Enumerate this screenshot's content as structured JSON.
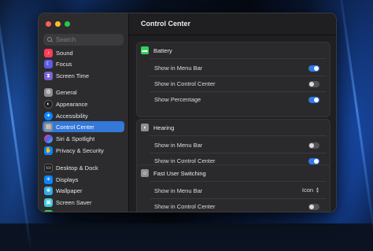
{
  "sidebar": {
    "search_placeholder": "Search",
    "items": [
      {
        "label": "Sound",
        "icon": "speaker-icon",
        "color": "#ff3b58"
      },
      {
        "label": "Focus",
        "icon": "moon-icon",
        "color": "#5e5ce6"
      },
      {
        "label": "Screen Time",
        "icon": "hourglass-icon",
        "color": "#7b61d9"
      },
      {
        "label": "General",
        "icon": "gear-icon",
        "color": "#8e8e93"
      },
      {
        "label": "Appearance",
        "icon": "appearance-icon",
        "color": "#1c1c1e"
      },
      {
        "label": "Accessibility",
        "icon": "accessibility-icon",
        "color": "#0a84ff"
      },
      {
        "label": "Control Center",
        "icon": "control-center-icon",
        "color": "#8e8e93"
      },
      {
        "label": "Siri & Spotlight",
        "icon": "siri-icon",
        "color": "#bf5af2"
      },
      {
        "label": "Privacy & Security",
        "icon": "hand-icon",
        "color": "#0a84ff"
      },
      {
        "label": "Desktop & Dock",
        "icon": "dock-icon",
        "color": "#1c1c1e"
      },
      {
        "label": "Displays",
        "icon": "display-icon",
        "color": "#0a84ff"
      },
      {
        "label": "Wallpaper",
        "icon": "wallpaper-icon",
        "color": "#32ade6"
      },
      {
        "label": "Screen Saver",
        "icon": "screen-saver-icon",
        "color": "#40c8e0"
      }
    ],
    "selected": "Control Center"
  },
  "main": {
    "title": "Control Center",
    "groups": [
      {
        "name": "Battery",
        "icon": "battery-icon",
        "icon_color": "#30d158",
        "rows": [
          {
            "label": "Show in Menu Bar",
            "type": "toggle",
            "on": true
          },
          {
            "label": "Show in Control Center",
            "type": "toggle",
            "on": false
          },
          {
            "label": "Show Percentage",
            "type": "toggle",
            "on": true
          }
        ]
      },
      {
        "name": "Hearing",
        "icon": "ear-icon",
        "icon_color": "#8e8e93",
        "rows": [
          {
            "label": "Show in Menu Bar",
            "type": "toggle",
            "on": false
          },
          {
            "label": "Show in Control Center",
            "type": "toggle",
            "on": true
          }
        ]
      },
      {
        "name": "Fast User Switching",
        "icon": "users-icon",
        "icon_color": "#8e8e93",
        "rows": [
          {
            "label": "Show in Menu Bar",
            "type": "select",
            "value": "Icon"
          },
          {
            "label": "Show in Control Center",
            "type": "toggle",
            "on": false
          }
        ]
      }
    ]
  },
  "colors": {
    "accent": "#2f7ae5",
    "window_close": "#ff5f57",
    "window_minimize": "#febc2e",
    "window_zoom": "#28c840"
  }
}
